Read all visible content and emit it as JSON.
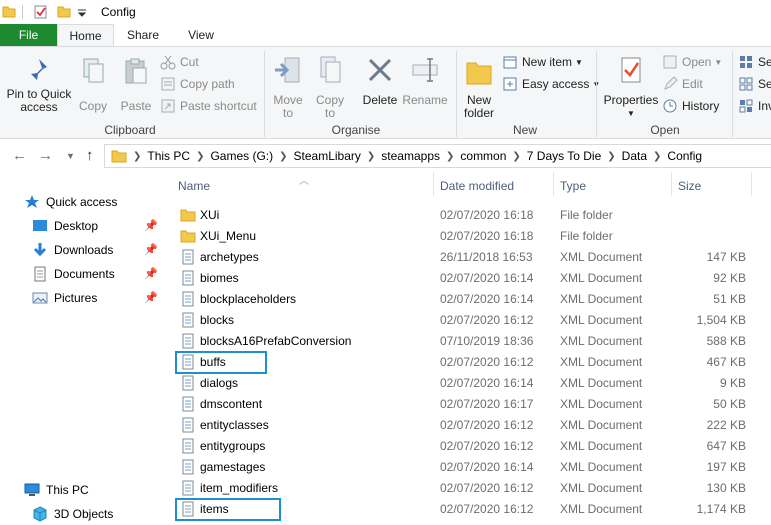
{
  "window": {
    "title": "Config"
  },
  "tabs": {
    "file": "File",
    "home": "Home",
    "share": "Share",
    "view": "View"
  },
  "ribbon": {
    "pin_line1": "Pin to Quick",
    "pin_line2": "access",
    "copy": "Copy",
    "paste": "Paste",
    "cut": "Cut",
    "copy_path": "Copy path",
    "paste_shortcut": "Paste shortcut",
    "move_to_line1": "Move",
    "move_to_line2": "to",
    "copy_to_line1": "Copy",
    "copy_to_line2": "to",
    "delete": "Delete",
    "rename": "Rename",
    "new_folder_line1": "New",
    "new_folder_line2": "folder",
    "new_item": "New item",
    "easy_access": "Easy access",
    "properties": "Properties",
    "open": "Open",
    "edit": "Edit",
    "history": "History",
    "select_all_partial": "Se",
    "select_none_partial": "Se",
    "invert_partial": "Inv",
    "groups": {
      "clipboard": "Clipboard",
      "organise": "Organise",
      "new": "New",
      "open": "Open"
    }
  },
  "address": {
    "crumbs": [
      "This PC",
      "Games (G:)",
      "SteamLibary",
      "steamapps",
      "common",
      "7 Days To Die",
      "Data",
      "Config"
    ]
  },
  "navpane": {
    "quick_access": "Quick access",
    "items": [
      "Desktop",
      "Downloads",
      "Documents",
      "Pictures"
    ],
    "this_pc": "This PC",
    "objects3d": "3D Objects"
  },
  "columns": {
    "name": "Name",
    "date": "Date modified",
    "type": "Type",
    "size": "Size"
  },
  "files": [
    {
      "name": "XUi",
      "date": "02/07/2020 16:18",
      "type": "File folder",
      "size": "",
      "kind": "folder"
    },
    {
      "name": "XUi_Menu",
      "date": "02/07/2020 16:18",
      "type": "File folder",
      "size": "",
      "kind": "folder"
    },
    {
      "name": "archetypes",
      "date": "26/11/2018 16:53",
      "type": "XML Document",
      "size": "147 KB",
      "kind": "xml"
    },
    {
      "name": "biomes",
      "date": "02/07/2020 16:14",
      "type": "XML Document",
      "size": "92 KB",
      "kind": "xml"
    },
    {
      "name": "blockplaceholders",
      "date": "02/07/2020 16:14",
      "type": "XML Document",
      "size": "51 KB",
      "kind": "xml"
    },
    {
      "name": "blocks",
      "date": "02/07/2020 16:12",
      "type": "XML Document",
      "size": "1,504 KB",
      "kind": "xml"
    },
    {
      "name": "blocksA16PrefabConversion",
      "date": "07/10/2019 18:36",
      "type": "XML Document",
      "size": "588 KB",
      "kind": "xml"
    },
    {
      "name": "buffs",
      "date": "02/07/2020 16:12",
      "type": "XML Document",
      "size": "467 KB",
      "kind": "xml"
    },
    {
      "name": "dialogs",
      "date": "02/07/2020 16:14",
      "type": "XML Document",
      "size": "9 KB",
      "kind": "xml"
    },
    {
      "name": "dmscontent",
      "date": "02/07/2020 16:17",
      "type": "XML Document",
      "size": "50 KB",
      "kind": "xml"
    },
    {
      "name": "entityclasses",
      "date": "02/07/2020 16:12",
      "type": "XML Document",
      "size": "222 KB",
      "kind": "xml"
    },
    {
      "name": "entitygroups",
      "date": "02/07/2020 16:12",
      "type": "XML Document",
      "size": "647 KB",
      "kind": "xml"
    },
    {
      "name": "gamestages",
      "date": "02/07/2020 16:14",
      "type": "XML Document",
      "size": "197 KB",
      "kind": "xml"
    },
    {
      "name": "item_modifiers",
      "date": "02/07/2020 16:12",
      "type": "XML Document",
      "size": "130 KB",
      "kind": "xml"
    },
    {
      "name": "items",
      "date": "02/07/2020 16:12",
      "type": "XML Document",
      "size": "1,174 KB",
      "kind": "xml"
    }
  ],
  "highlighted_files": [
    "buffs",
    "items"
  ],
  "colors": {
    "file_tab": "#1e8a30",
    "highlight": "#1e8fd0",
    "header_text": "#4c607a"
  }
}
